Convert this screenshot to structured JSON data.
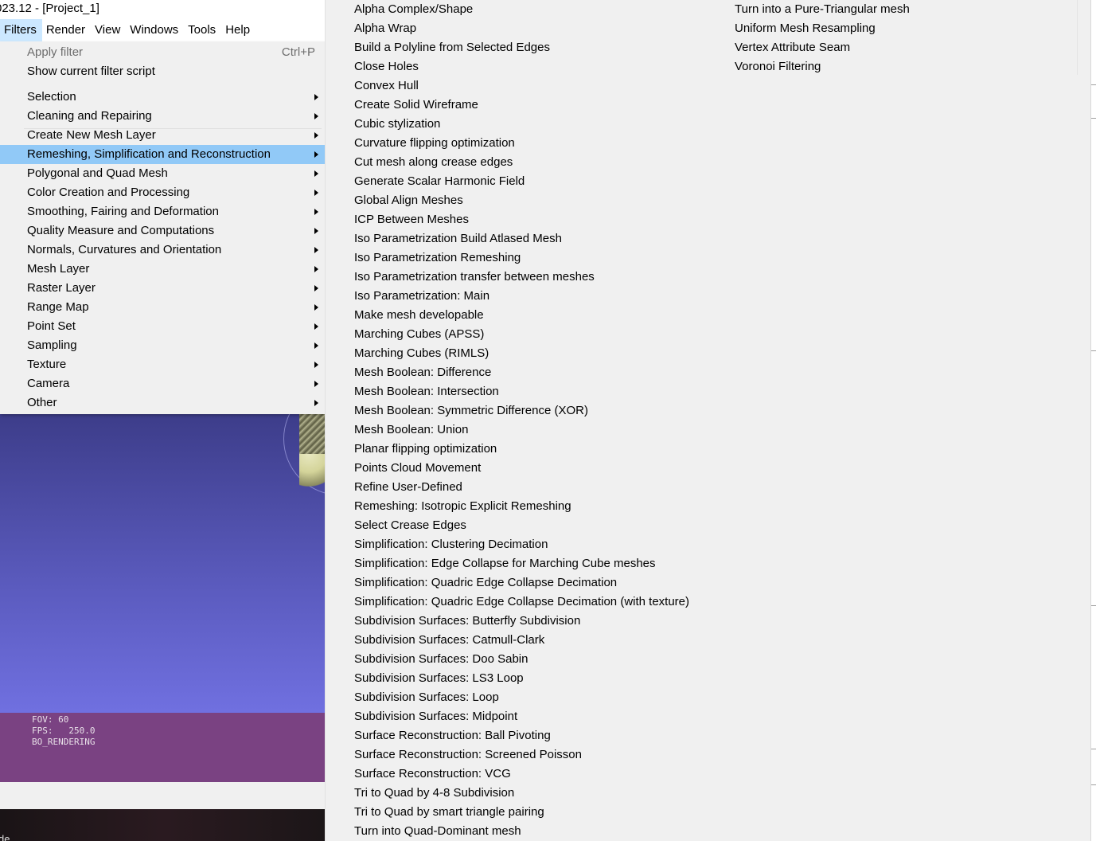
{
  "window": {
    "title": "023.12 - [Project_1]"
  },
  "menubar": {
    "items": [
      "Filters",
      "Render",
      "View",
      "Windows",
      "Tools",
      "Help"
    ]
  },
  "filters_menu": {
    "apply_filter": {
      "label": "Apply filter",
      "shortcut": "Ctrl+P"
    },
    "show_script": "Show current filter script",
    "categories": [
      "Selection",
      "Cleaning and Repairing",
      "Create New Mesh Layer",
      "Remeshing, Simplification and Reconstruction",
      "Polygonal and Quad Mesh",
      "Color Creation and Processing",
      "Smoothing, Fairing and Deformation",
      "Quality Measure and Computations",
      "Normals, Curvatures and Orientation",
      "Mesh Layer",
      "Raster Layer",
      "Range Map",
      "Point Set",
      "Sampling",
      "Texture",
      "Camera",
      "Other"
    ],
    "highlighted": "Remeshing, Simplification and Reconstruction"
  },
  "submenu": {
    "column1": [
      "Alpha Complex/Shape",
      "Alpha Wrap",
      "Build a Polyline from Selected Edges",
      "Close Holes",
      "Convex Hull",
      "Create Solid Wireframe",
      "Cubic stylization",
      "Curvature flipping optimization",
      "Cut mesh along crease edges",
      "Generate Scalar Harmonic Field",
      "Global Align Meshes",
      "ICP Between Meshes",
      "Iso Parametrization Build Atlased Mesh",
      "Iso Parametrization Remeshing",
      "Iso Parametrization transfer between meshes",
      "Iso Parametrization: Main",
      "Make mesh developable",
      "Marching Cubes (APSS)",
      "Marching Cubes (RIMLS)",
      "Mesh Boolean: Difference",
      "Mesh Boolean: Intersection",
      "Mesh Boolean: Symmetric Difference (XOR)",
      "Mesh Boolean: Union",
      "Planar flipping optimization",
      "Points Cloud Movement",
      "Refine User-Defined",
      "Remeshing: Isotropic Explicit Remeshing",
      "Select Crease Edges",
      "Simplification: Clustering Decimation",
      "Simplification: Edge Collapse for Marching Cube meshes",
      "Simplification: Quadric Edge Collapse Decimation",
      "Simplification: Quadric Edge Collapse Decimation (with texture)",
      "Subdivision Surfaces: Butterfly Subdivision",
      "Subdivision Surfaces: Catmull-Clark",
      "Subdivision Surfaces: Doo Sabin",
      "Subdivision Surfaces: LS3 Loop",
      "Subdivision Surfaces: Loop",
      "Subdivision Surfaces: Midpoint",
      "Surface Reconstruction: Ball Pivoting",
      "Surface Reconstruction: Screened Poisson",
      "Surface Reconstruction: VCG",
      "Tri to Quad by 4-8 Subdivision",
      "Tri to Quad by smart triangle pairing",
      "Turn into Quad-Dominant mesh"
    ],
    "column2": [
      "Turn into a Pure-Triangular mesh",
      "Uniform Mesh Resampling",
      "Vertex Attribute Seam",
      "Voronoi Filtering"
    ]
  },
  "viewport_info": {
    "fov": "FOV: 60",
    "fps": "FPS:   250.0",
    "mode": "BO_RENDERING"
  },
  "status_fragment": "de"
}
